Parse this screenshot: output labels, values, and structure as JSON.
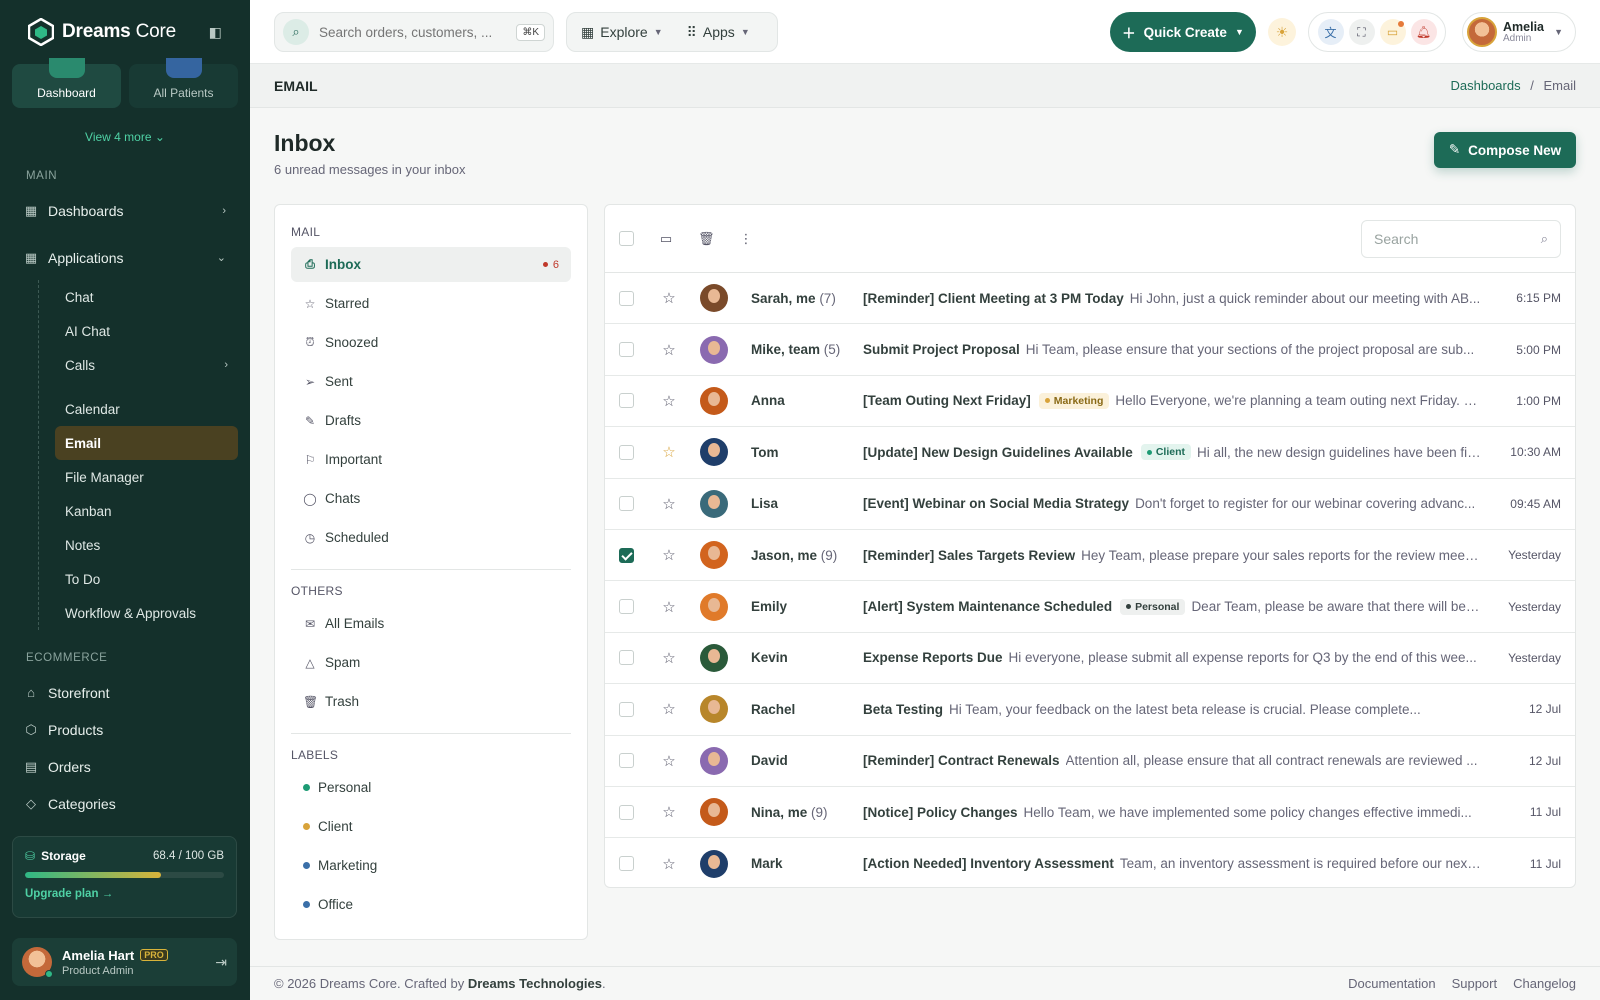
{
  "brand": {
    "name_bold": "Dreams",
    "name_light": " Core"
  },
  "sidebar": {
    "tiles": [
      {
        "label": "Dashboard"
      },
      {
        "label": "All Patients"
      }
    ],
    "view_more": "View 4 more",
    "main_section": "MAIN",
    "main_items": [
      {
        "label": "Dashboards",
        "icon": "grid-icon"
      },
      {
        "label": "Applications",
        "icon": "grid-icon"
      }
    ],
    "app_subitems": [
      {
        "label": "Chat"
      },
      {
        "label": "AI Chat"
      },
      {
        "label": "Calls"
      },
      {
        "label": "Calendar"
      },
      {
        "label": "Email"
      },
      {
        "label": "File Manager"
      },
      {
        "label": "Kanban"
      },
      {
        "label": "Notes"
      },
      {
        "label": "To Do"
      },
      {
        "label": "Workflow & Approvals"
      }
    ],
    "ecommerce_section": "ECOMMERCE",
    "ecommerce_items": [
      {
        "label": "Storefront"
      },
      {
        "label": "Products"
      },
      {
        "label": "Orders"
      },
      {
        "label": "Categories"
      }
    ],
    "storage": {
      "title": "Storage",
      "value": "68.4 / 100 GB",
      "used_fraction": 0.684,
      "link": "Upgrade plan"
    },
    "user": {
      "name": "Amelia Hart",
      "badge": "PRO",
      "role": "Product Admin"
    }
  },
  "topbar": {
    "search_placeholder": "Search orders, customers, ...",
    "search_shortcut": "⌘K",
    "explore": "Explore",
    "apps": "Apps",
    "quick_create": "Quick Create",
    "user": {
      "name": "Amelia",
      "role": "Admin"
    }
  },
  "page": {
    "header": "EMAIL",
    "breadcrumb": {
      "parent": "Dashboards",
      "sep": "/",
      "current": "Email"
    },
    "title": "Inbox",
    "subtitle": "6 unread messages in your inbox",
    "compose": "Compose New"
  },
  "mailnav": {
    "mail_section": "MAIL",
    "mail_items": [
      {
        "label": "Inbox",
        "icon": "inbox-icon",
        "count": "6"
      },
      {
        "label": "Starred",
        "icon": "star-icon"
      },
      {
        "label": "Snoozed",
        "icon": "alarm-icon"
      },
      {
        "label": "Sent",
        "icon": "send-icon"
      },
      {
        "label": "Drafts",
        "icon": "pencil-icon"
      },
      {
        "label": "Important",
        "icon": "flag-icon"
      },
      {
        "label": "Chats",
        "icon": "chat-icon"
      },
      {
        "label": "Scheduled",
        "icon": "clock-icon"
      }
    ],
    "others_section": "OTHERS",
    "others_items": [
      {
        "label": "All Emails",
        "icon": "mail-icon"
      },
      {
        "label": "Spam",
        "icon": "warning-icon"
      },
      {
        "label": "Trash",
        "icon": "trash-icon"
      }
    ],
    "labels_section": "LABELS",
    "labels": [
      {
        "label": "Personal",
        "color": "#1d9b74"
      },
      {
        "label": "Client",
        "color": "#d8a33a"
      },
      {
        "label": "Marketing",
        "color": "#3a6fa8"
      },
      {
        "label": "Office",
        "color": "#3a6fa8"
      }
    ]
  },
  "maillist": {
    "search_placeholder": "Search",
    "emails": [
      {
        "sender": "Sarah, me",
        "count": "(7)",
        "subject": "[Reminder] Client Meeting at 3 PM Today",
        "tag": "",
        "preview": "Hi John, just a quick reminder about our meeting with AB...",
        "time": "6:15 PM",
        "starred": false,
        "checked": false,
        "avatar": "#7a4a2a"
      },
      {
        "sender": "Mike, team",
        "count": "(5)",
        "subject": "Submit Project Proposal",
        "tag": "",
        "preview": "Hi Team, please ensure that your sections of the project proposal are sub...",
        "time": "5:00 PM",
        "starred": false,
        "checked": false,
        "avatar": "#8a6ab0"
      },
      {
        "sender": "Anna",
        "count": "",
        "subject": "[Team Outing Next Friday]",
        "tag": "Marketing",
        "preview": "Hello Everyone, we're planning a team outing next Friday. Pl...",
        "time": "1:00 PM",
        "starred": false,
        "checked": false,
        "avatar": "#c45a1a"
      },
      {
        "sender": "Tom",
        "count": "",
        "subject": "[Update] New Design Guidelines Available",
        "tag": "Client",
        "preview": "Hi all, the new design guidelines have been fina...",
        "time": "10:30 AM",
        "starred": true,
        "checked": false,
        "avatar": "#1f3e6a"
      },
      {
        "sender": "Lisa",
        "count": "",
        "subject": "[Event] Webinar on Social Media Strategy",
        "tag": "",
        "preview": "Don't forget to register for our webinar covering advanc...",
        "time": "09:45 AM",
        "starred": false,
        "checked": false,
        "avatar": "#3a6a7a"
      },
      {
        "sender": "Jason, me",
        "count": "(9)",
        "subject": "[Reminder] Sales Targets Review",
        "tag": "",
        "preview": "Hey Team, please prepare your sales reports for the review meeti...",
        "time": "Yesterday",
        "starred": false,
        "checked": true,
        "avatar": "#d2641e"
      },
      {
        "sender": "Emily",
        "count": "",
        "subject": "[Alert] System Maintenance Scheduled",
        "tag": "Personal",
        "preview": "Dear Team, please be aware that there will be sy...",
        "time": "Yesterday",
        "starred": false,
        "checked": false,
        "avatar": "#e07a2a"
      },
      {
        "sender": "Kevin",
        "count": "",
        "subject": "Expense Reports Due",
        "tag": "",
        "preview": "Hi everyone, please submit all expense reports for Q3 by the end of this wee...",
        "time": "Yesterday",
        "starred": false,
        "checked": false,
        "avatar": "#2a5a3a"
      },
      {
        "sender": "Rachel",
        "count": "",
        "subject": "Beta Testing",
        "tag": "",
        "preview": "Hi Team, your feedback on the latest beta release is crucial. Please complete...",
        "time": "12 Jul",
        "starred": false,
        "checked": false,
        "avatar": "#b8862a"
      },
      {
        "sender": "David",
        "count": "",
        "subject": "[Reminder] Contract Renewals",
        "tag": "",
        "preview": "Attention all, please ensure that all contract renewals are reviewed ...",
        "time": "12 Jul",
        "starred": false,
        "checked": false,
        "avatar": "#8a6ab0"
      },
      {
        "sender": "Nina, me",
        "count": "(9)",
        "subject": "[Notice] Policy Changes",
        "tag": "",
        "preview": "Hello Team, we have implemented some policy changes effective immedi...",
        "time": "11 Jul",
        "starred": false,
        "checked": false,
        "avatar": "#c45a1a"
      },
      {
        "sender": "Mark",
        "count": "",
        "subject": "[Action Needed] Inventory Assessment",
        "tag": "",
        "preview": "Team, an inventory assessment is required before our next ...",
        "time": "11 Jul",
        "starred": false,
        "checked": false,
        "avatar": "#1f3e6a"
      }
    ]
  },
  "footer": {
    "copyright": "© 2026 Dreams Core. Crafted by ",
    "company": "Dreams Technologies",
    "period": ".",
    "links": [
      "Documentation",
      "Support",
      "Changelog"
    ]
  }
}
